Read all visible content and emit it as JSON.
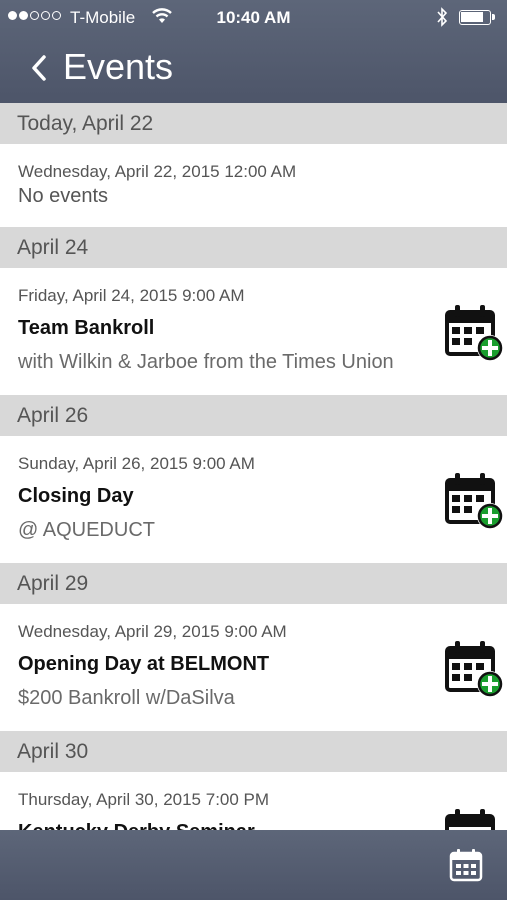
{
  "status_bar": {
    "carrier": "T-Mobile",
    "time": "10:40 AM"
  },
  "nav": {
    "title": "Events"
  },
  "sections": [
    {
      "header": "Today, April 22",
      "items": [
        {
          "datetime": "Wednesday, April 22, 2015 12:00 AM",
          "empty_text": "No events"
        }
      ]
    },
    {
      "header": "April 24",
      "items": [
        {
          "datetime": "Friday, April 24, 2015 9:00 AM",
          "title": "Team Bankroll",
          "subtitle": "with Wilkin & Jarboe from the Times Union"
        }
      ]
    },
    {
      "header": "April 26",
      "items": [
        {
          "datetime": "Sunday, April 26, 2015 9:00 AM",
          "title": "Closing Day",
          "subtitle": "@ AQUEDUCT"
        }
      ]
    },
    {
      "header": "April 29",
      "items": [
        {
          "datetime": "Wednesday, April 29, 2015 9:00 AM",
          "title": "Opening Day at BELMONT",
          "subtitle": "$200 Bankroll w/DaSilva"
        }
      ]
    },
    {
      "header": "April 30",
      "items": [
        {
          "datetime": "Thursday, April 30, 2015 7:00 PM",
          "title": "Kentucky Derby Seminar",
          "subtitle": ""
        }
      ]
    }
  ],
  "colors": {
    "bar": "#535b6e",
    "section_header": "#d8d8d8",
    "add_badge": "#1a9e2e"
  }
}
